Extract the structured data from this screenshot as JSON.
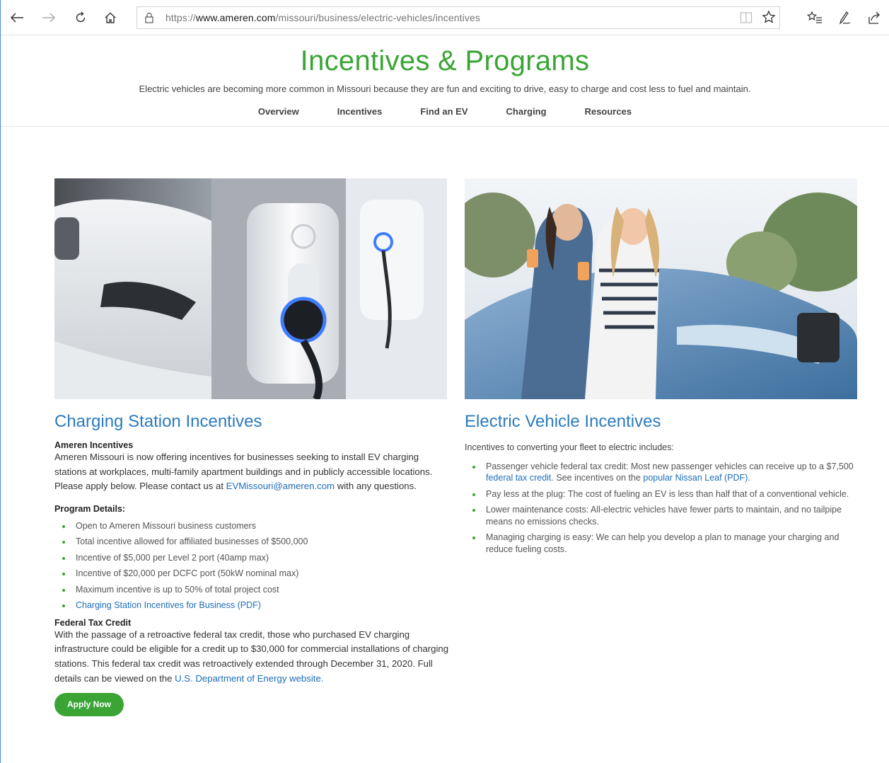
{
  "browser": {
    "url_prefix": "https://",
    "url_domain": "www.ameren.com",
    "url_path": "/missouri/business/electric-vehicles/incentives"
  },
  "header": {
    "title": "Incentives & Programs",
    "subtitle": "Electric vehicles are becoming more common in Missouri because they are fun and exciting to drive, easy to charge and cost less to fuel and maintain.",
    "nav": [
      "Overview",
      "Incentives",
      "Find an EV",
      "Charging",
      "Resources"
    ]
  },
  "left": {
    "heading": "Charging Station Incentives",
    "ameren_title": "Ameren Incentives",
    "ameren_text": "Ameren Missouri is now offering incentives for businesses seeking to install EV charging stations at workplaces, multi-family apartment buildings and in publicly accessible locations. Please apply below. Please contact us at",
    "ameren_email": "EVMissouri@ameren.com",
    "ameren_text_end": "with any questions.",
    "program_title": "Program Details:",
    "program_items": [
      "Open to Ameren Missouri business customers",
      "Total incentive allowed for affiliated businesses of $500,000",
      "Incentive of $5,000 per Level 2 port (40amp max)",
      "Incentive of $20,000 per DCFC port (50kW nominal max)",
      "Maximum incentive is up to 50% of total project cost"
    ],
    "program_link": "Charging Station Incentives for Business (PDF)",
    "federal_title": "Federal Tax Credit",
    "federal_text": "With the passage of a retroactive federal tax credit, those who purchased EV charging infrastructure could be eligible for a credit up to $30,000 for commercial installations of charging stations. This federal tax credit was retroactively extended through December 31, 2020. Full details can be viewed on the",
    "federal_link": "U.S. Department of Energy website.",
    "apply_label": "Apply Now"
  },
  "right": {
    "heading": "Electric Vehicle Incentives",
    "intro": "Incentives to converting your fleet to electric includes:",
    "item1_a": "Passenger vehicle federal tax credit: Most new passenger vehicles can receive up to a $7,500",
    "item1_link1": "federal tax credit",
    "item1_b": ". See incentives on the",
    "item1_link2": "popular Nissan Leaf (PDF)",
    "item1_c": ".",
    "items": [
      "Pay less at the plug: The cost of fueling an EV is less than half that of a conventional vehicle.",
      "Lower maintenance costs: All-electric vehicles have fewer parts to maintain, and no tailpipe means no emissions checks.",
      "Managing charging is easy: We can help you develop a plan to manage your charging and reduce fueling costs."
    ]
  },
  "colors": {
    "brand_green": "#3aa535",
    "link_blue": "#1e6db7",
    "heading_blue": "#2b7bbf"
  }
}
